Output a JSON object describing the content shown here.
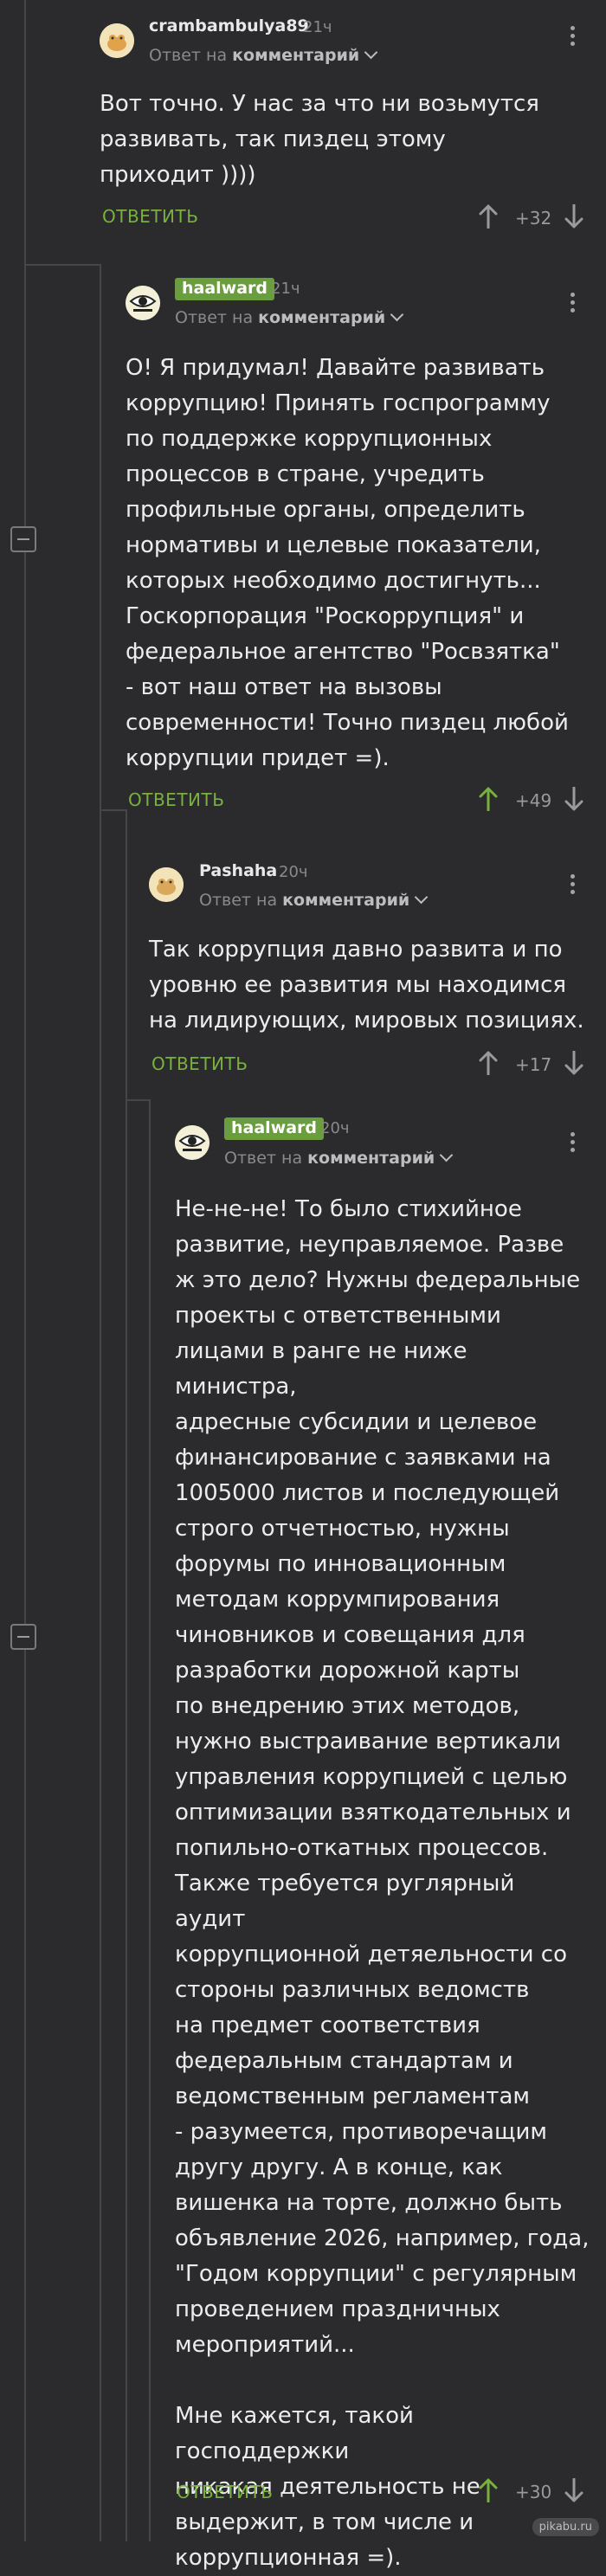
{
  "common": {
    "reply_prefix": "Ответ на",
    "reply_target": "комментарий",
    "answer_label": "ОТВЕТИТЬ"
  },
  "comments": [
    {
      "username": "crambambulya89",
      "time": "21ч",
      "text": "Вот точно. У нас за что ни возьмутся\nразвивать, так пиздец этому\nприходит ))))",
      "rating": "+32"
    },
    {
      "username": "haalward",
      "time": "21ч",
      "text": "О! Я придумал! Давайте развивать\nкоррупцию! Принять госпрограмму\nпо поддержке коррупционных\nпроцессов в стране, учредить\nпрофильные органы, определить\nнормативы и целевые показатели,\nкоторых необходимо достигнуть...\nГоскорпорация \"Роскоррупция\" и\nфедеральное агентство \"Росвзятка\"\n- вот наш ответ на вызовы\nсовременности! Точно пиздец любой\nкоррупции придет =).",
      "rating": "+49"
    },
    {
      "username": "Pashaha",
      "time": "20ч",
      "text": "Так коррупция давно развита и по\nуровню ее развития мы находимся\nна лидирующих, мировых позициях.",
      "rating": "+17"
    },
    {
      "username": "haalward",
      "time": "20ч",
      "text": "Не-не-не! То было стихийное\nразвитие, неуправляемое. Разве\nж это дело? Нужны федеральные\nпроекты с ответственными\nлицами в ранге не ниже министра,\nадресные субсидии и целевое\nфинансирование с заявками на\n1005000 листов и последующей\nстрого отчетностью, нужны\nфорумы по инновационным\nметодам коррумпирования\nчиновников и совещания для\nразработки дорожной карты\nпо внедрению этих методов,\nнужно выстраивание вертикали\nуправления коррупцией с целью\nоптимизации взяткодательных и\nпопильно-откатных процессов.\nТакже требуется руглярный аудит\nкоррупционной детяельности со\nстороны различных ведомств\nна предмет соответствия\nфедеральным стандартам и\nведомственным регламентам\n- разумеется, противоречащим\nдругу другу. А в конце, как\nвишенка на торте, должно быть\nобъявление 2026, например, года,\n\"Годом коррупции\" с регулярным\nпроведением праздничных\nмероприятий...\n\nМне кажется, такой господдержки\nникакая деятельность не\nвыдержит, в том числе и\nкоррупционная =).",
      "rating": "+30"
    }
  ],
  "watermark": "pikabu.ru",
  "colors": {
    "background": "#2b2b2d",
    "accent_green": "#79b13f",
    "badge_green": "#6a9d3d",
    "muted": "#8a8a8a"
  }
}
